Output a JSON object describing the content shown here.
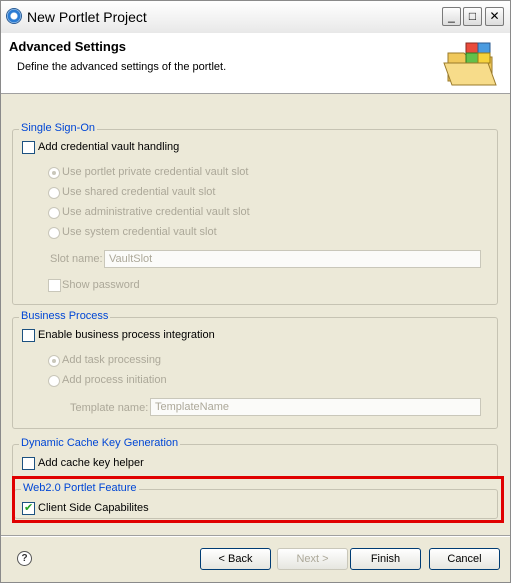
{
  "window": {
    "title": "New Portlet Project",
    "min_label": "_",
    "max_label": "□",
    "close_label": "✕"
  },
  "header": {
    "title": "Advanced Settings",
    "description": "Define the advanced settings of the portlet."
  },
  "sso": {
    "legend": "Single Sign-On",
    "vault_checkbox": {
      "label": "Add credential vault handling",
      "checked": false
    },
    "radios": [
      {
        "label": "Use portlet private credential vault slot",
        "selected": true
      },
      {
        "label": "Use shared credential vault slot",
        "selected": false
      },
      {
        "label": "Use administrative credential vault slot",
        "selected": false
      },
      {
        "label": "Use system credential vault slot",
        "selected": false
      }
    ],
    "slot_name_label": "Slot name:",
    "slot_name_value": "VaultSlot",
    "show_password": {
      "label": "Show password",
      "checked": false
    }
  },
  "business": {
    "legend": "Business Process",
    "enable_checkbox": {
      "label": "Enable business process integration",
      "checked": false
    },
    "radios": [
      {
        "label": "Add task processing",
        "selected": true
      },
      {
        "label": "Add process initiation",
        "selected": false
      }
    ],
    "template_label": "Template name:",
    "template_value": "TemplateName"
  },
  "cache": {
    "legend": "Dynamic Cache Key Generation",
    "helper_checkbox": {
      "label": "Add cache key helper",
      "checked": false
    }
  },
  "web2": {
    "legend": "Web2.0 Portlet Feature",
    "client_checkbox": {
      "label": "Client Side Capabilites",
      "checked": true
    }
  },
  "footer": {
    "help_label": "?",
    "back_label": "< Back",
    "next_label": "Next >",
    "finish_label": "Finish",
    "cancel_label": "Cancel"
  },
  "colors": {
    "legend": "#0046d5",
    "highlight": "#e00000",
    "check": "#21a121"
  }
}
